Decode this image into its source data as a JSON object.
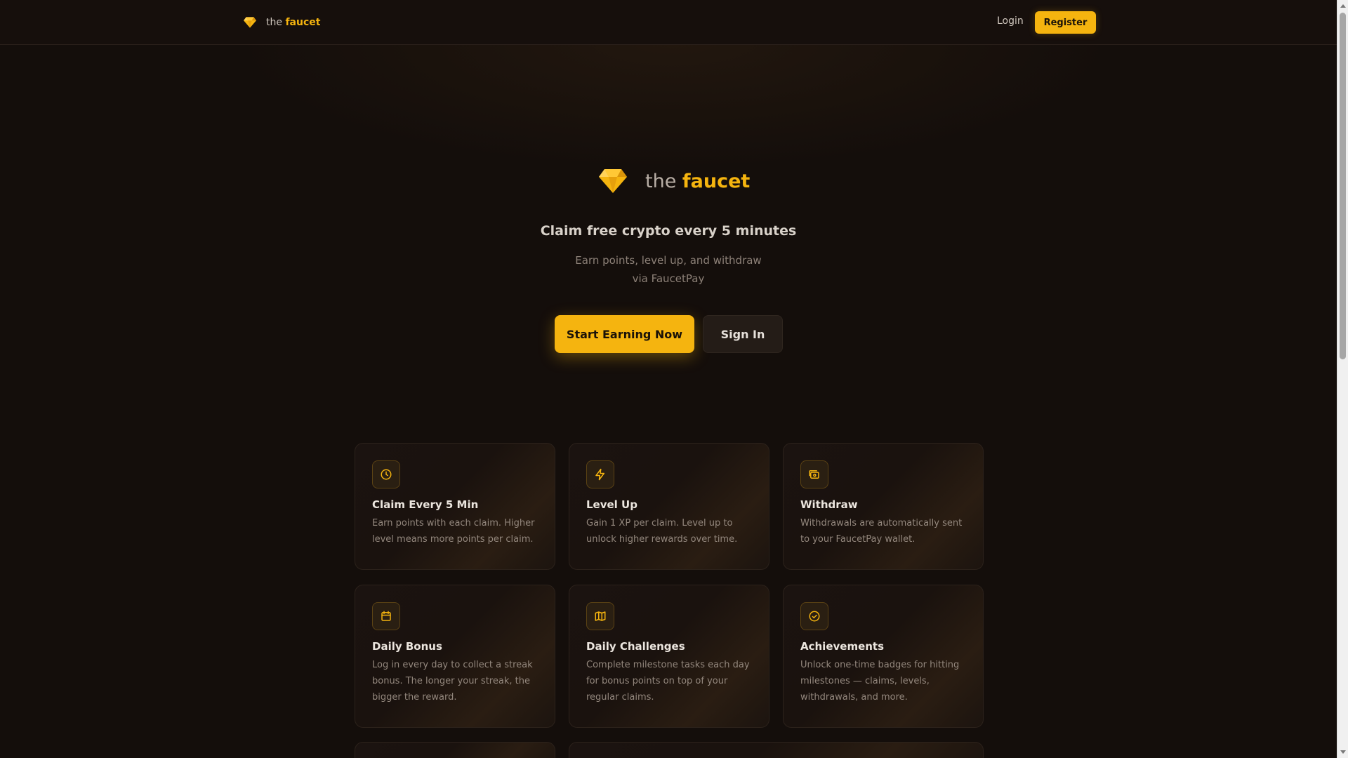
{
  "nav": {
    "brand_prefix": "the",
    "brand_name": "faucet",
    "login_label": "Login",
    "register_label": "Register"
  },
  "hero": {
    "brand_prefix": "the",
    "brand_name": "faucet",
    "title": "Claim free crypto every 5 minutes",
    "subtitle": "Earn points, level up, and withdraw via FaucetPay",
    "primary_button": "Start Earning Now",
    "secondary_button": "Sign In"
  },
  "features": [
    {
      "icon": "clock-icon",
      "title": "Claim Every 5 Min",
      "description": "Earn points with each claim. Higher level means more points per claim."
    },
    {
      "icon": "lightning-icon",
      "title": "Level Up",
      "description": "Gain 1 XP per claim. Level up to unlock higher rewards over time."
    },
    {
      "icon": "wallet-icon",
      "title": "Withdraw",
      "description": "Withdrawals are automatically sent to your FaucetPay wallet."
    },
    {
      "icon": "calendar-icon",
      "title": "Daily Bonus",
      "description": "Log in every day to collect a streak bonus. The longer your streak, the bigger the reward."
    },
    {
      "icon": "map-icon",
      "title": "Daily Challenges",
      "description": "Complete milestone tasks each day for bonus points on top of your regular claims."
    },
    {
      "icon": "check-circle-icon",
      "title": "Achievements",
      "description": "Unlock one-time badges for hitting milestones — claims, levels, withdrawals, and more."
    }
  ],
  "colors": {
    "accent": "#f5b40f",
    "background": "#140e0b",
    "card_border": "#2c221b"
  }
}
